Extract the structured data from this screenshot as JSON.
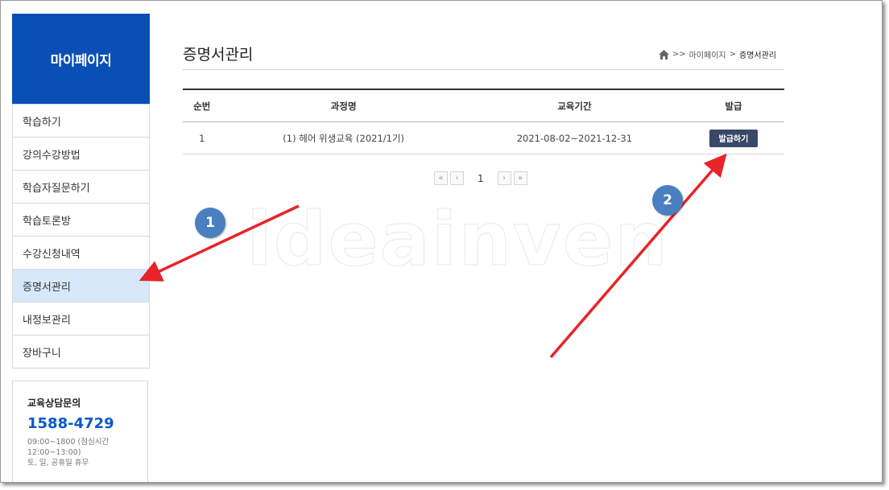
{
  "sidebar": {
    "title": "마이페이지",
    "items": [
      {
        "label": "학습하기"
      },
      {
        "label": "강의수강방법"
      },
      {
        "label": "학습자질문하기"
      },
      {
        "label": "학습토론방"
      },
      {
        "label": "수강신청내역"
      },
      {
        "label": "증명서관리",
        "active": true
      },
      {
        "label": "내정보관리"
      },
      {
        "label": "장바구니"
      }
    ],
    "contact": {
      "title": "교육상담문의",
      "phone": "1588-4729",
      "hours": "09:00~1800 (점심시간 12:00~13:00)",
      "holidays": "토, 일, 공휴일 휴무"
    }
  },
  "main": {
    "title": "증명서관리",
    "breadcrumb": {
      "home_icon": "home-icon",
      "separator1": ">>",
      "level1": "마이페이지",
      "separator2": ">",
      "current": "증명서관리"
    },
    "table": {
      "headers": [
        "순번",
        "과정명",
        "교육기간",
        "발급"
      ],
      "rows": [
        {
          "no": "1",
          "course": "(1) 헤어 위생교육 (2021/1기)",
          "period": "2021-08-02~2021-12-31",
          "button": "발급하기"
        }
      ]
    },
    "pagination": {
      "first": "«",
      "prev": "‹",
      "current": "1",
      "next": "›",
      "last": "»"
    }
  },
  "watermark": "ideainven",
  "annotations": {
    "marker1": "1",
    "marker2": "2",
    "arrow_color": "#e8232a",
    "circle_color": "#4a7fc0"
  },
  "colors": {
    "brand": "#0a4fb5",
    "active_item": "#d7e8fb",
    "button": "#3a4868",
    "phone": "#0a5ac8"
  }
}
